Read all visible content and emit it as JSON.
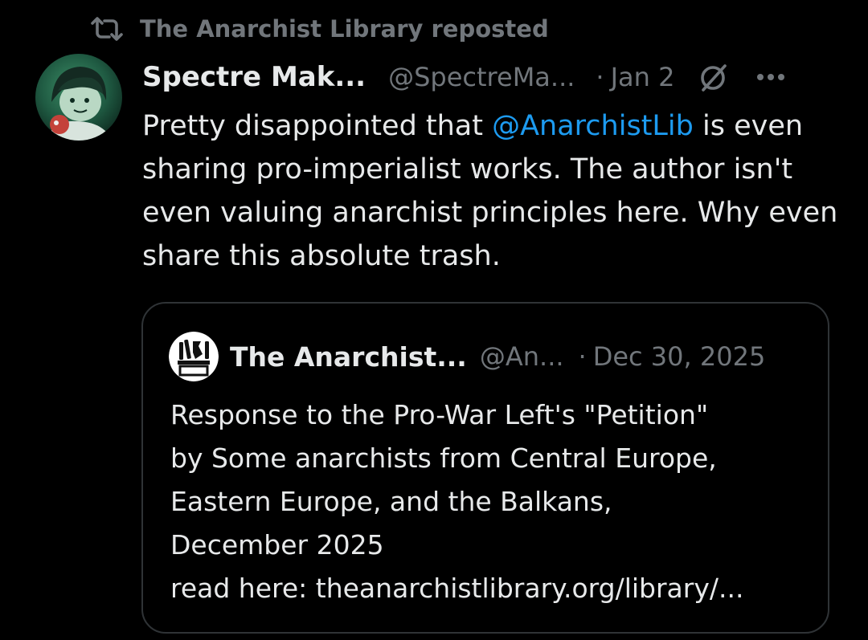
{
  "repost": {
    "icon": "repost-icon",
    "label": "The Anarchist Library reposted"
  },
  "post": {
    "avatar_icon": "avatar-image",
    "display_name": "Spectre Mak...",
    "handle": "@SpectreMa...",
    "separator": "·",
    "date": "Jan 2",
    "grok_icon": "grok-icon",
    "more_icon": "more-icon",
    "text_before_mention": "Pretty disappointed that ",
    "mention": "@AnarchistLib",
    "text_after_mention": " is even sharing pro-imperialist works. The author isn't even valuing anarchist principles here. Why even share this absolute trash."
  },
  "quote": {
    "avatar_icon": "library-logo-avatar",
    "display_name": "The Anarchist...",
    "handle": "@An...",
    "separator": "·",
    "date": "Dec 30, 2025",
    "lines": [
      "Response to the Pro-War Left's \"Petition\"",
      "by Some anarchists from Central Europe,",
      "Eastern Europe, and the Balkans,",
      "December 2025",
      "read here: theanarchistlibrary.org/library/..."
    ]
  },
  "colors": {
    "background": "#000000",
    "text": "#e7e9ea",
    "secondary": "#71767b",
    "link": "#1d9bf0",
    "border": "#2f3336"
  }
}
